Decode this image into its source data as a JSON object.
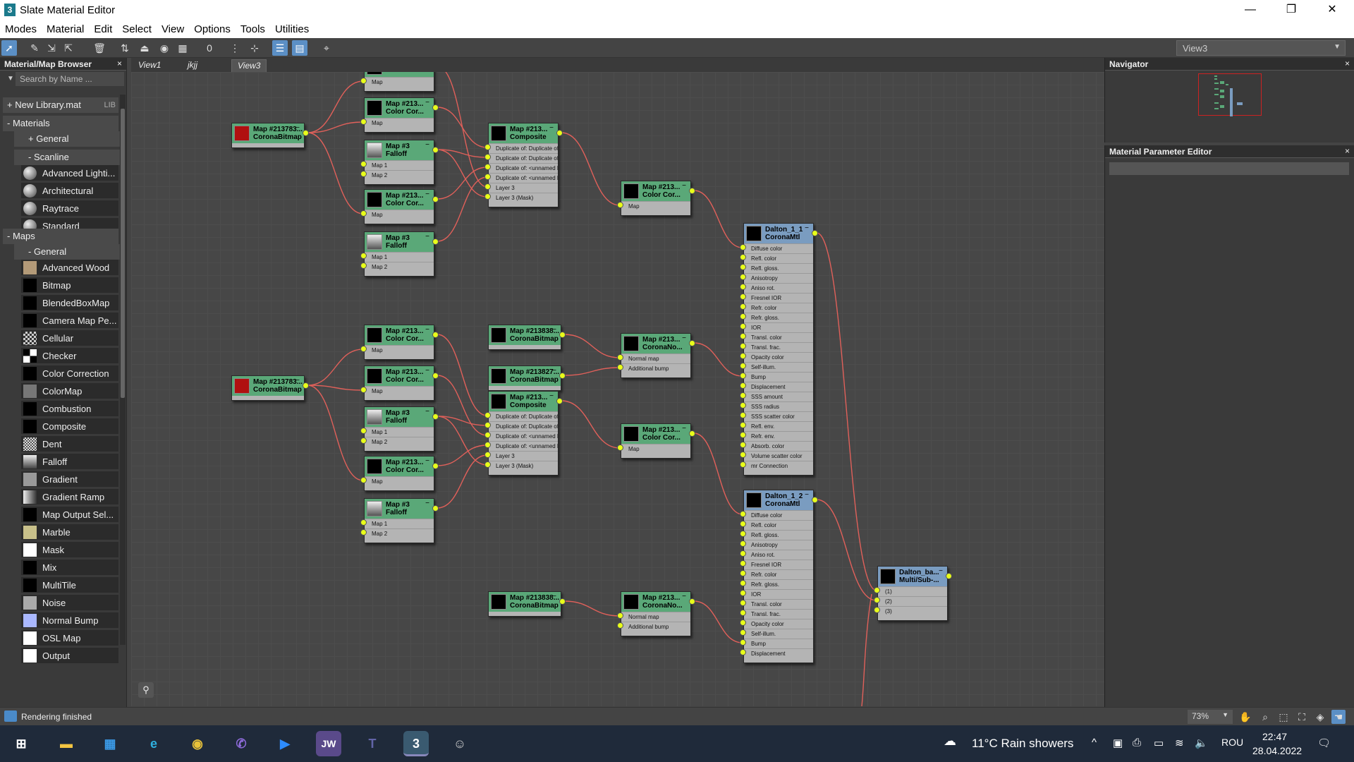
{
  "window": {
    "title": "Slate Material Editor",
    "minimize": "—",
    "restore": "❐",
    "close": "✕"
  },
  "menu": [
    "Modes",
    "Material",
    "Edit",
    "Select",
    "View",
    "Options",
    "Tools",
    "Utilities"
  ],
  "view_dropdown": "View3",
  "browser": {
    "title": "Material/Map Browser",
    "close": "×",
    "search_placeholder": "Search by Name ...",
    "library": "+ New Library.mat",
    "library_tag": "LIB",
    "materials": "- Materials",
    "general_mat": "+ General",
    "scanline": "- Scanline",
    "scanline_items": [
      "Advanced Lighti...",
      "Architectural",
      "Raytrace",
      "Standard"
    ],
    "maps": "- Maps",
    "general_maps": "- General",
    "map_items": [
      "Advanced Wood",
      "Bitmap",
      "BlendedBoxMap",
      "Camera Map Pe...",
      "Cellular",
      "Checker",
      "Color Correction",
      "ColorMap",
      "Combustion",
      "Composite",
      "Dent",
      "Falloff",
      "Gradient",
      "Gradient Ramp",
      "Map Output Sel...",
      "Marble",
      "Mask",
      "Mix",
      "MultiTile",
      "Noise",
      "Normal Bump",
      "OSL Map",
      "Output"
    ]
  },
  "tabs": [
    "View1",
    "jkjj",
    "View3"
  ],
  "nodes": {
    "top_map": {
      "title": "",
      "type": "",
      "slots": [
        "Map"
      ]
    },
    "bmp1": {
      "title": "Map #213783...",
      "type": "CoronaBitmap"
    },
    "cc1": {
      "title": "Map #213...",
      "type": "Color Cor...",
      "slots": [
        "Map"
      ]
    },
    "fo1": {
      "title": "Map #3",
      "type": "Falloff",
      "slots": [
        "Map 1",
        "Map 2"
      ]
    },
    "cc2": {
      "title": "Map #213...",
      "type": "Color Cor...",
      "slots": [
        "Map"
      ]
    },
    "fo2": {
      "title": "Map #3",
      "type": "Falloff",
      "slots": [
        "Map 1",
        "Map 2"
      ]
    },
    "comp1": {
      "title": "Map #213...",
      "type": "Composite",
      "slots": [
        "Duplicate of: Duplicate of...",
        "Duplicate of: Duplicate of...",
        "Duplicate of: <unnamed l...",
        "Duplicate of: <unnamed l...",
        "Layer 3",
        "Layer 3 (Mask)"
      ]
    },
    "cc3": {
      "title": "Map #213...",
      "type": "Color Cor...",
      "slots": [
        "Map"
      ]
    },
    "mtl1": {
      "title": "Dalton_1_1",
      "type": "CoronaMtl",
      "slots": [
        "Diffuse color",
        "Refl. color",
        "Refl. gloss.",
        "Anisotropy",
        "Aniso rot.",
        "Fresnel IOR",
        "Refr. color",
        "Refr. gloss.",
        "IOR",
        "Transl. color",
        "Transl. frac.",
        "Opacity color",
        "Self-illum.",
        "Bump",
        "Displacement",
        "SSS amount",
        "SSS radius",
        "SSS scatter color",
        "Refl. env.",
        "Refr. env.",
        "Absorb. color",
        "Volume scatter color",
        "mr Connection"
      ]
    },
    "cc4": {
      "title": "Map #213...",
      "type": "Color Cor...",
      "slots": [
        "Map"
      ]
    },
    "bmp2": {
      "title": "Map #213838...",
      "type": "CoronaBitmap"
    },
    "nrm1": {
      "title": "Map #213...",
      "type": "CoronaNo...",
      "slots": [
        "Normal map",
        "Additional bump"
      ]
    },
    "bmp3": {
      "title": "Map #213827...",
      "type": "CoronaBitmap"
    },
    "bmp4": {
      "title": "Map #213783...",
      "type": "CoronaBitmap"
    },
    "cc5": {
      "title": "Map #213...",
      "type": "Color Cor...",
      "slots": [
        "Map"
      ]
    },
    "comp2": {
      "title": "Map #213...",
      "type": "Composite",
      "slots": [
        "Duplicate of: Duplicate of...",
        "Duplicate of: Duplicate of...",
        "Duplicate of: <unnamed l...",
        "Duplicate of: <unnamed l...",
        "Layer 3",
        "Layer 3 (Mask)"
      ]
    },
    "fo3": {
      "title": "Map #3",
      "type": "Falloff",
      "slots": [
        "Map 1",
        "Map 2"
      ]
    },
    "cc6": {
      "title": "Map #213...",
      "type": "Color Cor...",
      "slots": [
        "Map"
      ]
    },
    "cc7": {
      "title": "Map #213...",
      "type": "Color Cor...",
      "slots": [
        "Map"
      ]
    },
    "fo4": {
      "title": "Map #3",
      "type": "Falloff",
      "slots": [
        "Map 1",
        "Map 2"
      ]
    },
    "mtl2": {
      "title": "Dalton_1_2",
      "type": "CoronaMtl",
      "slots": [
        "Diffuse color",
        "Refl. color",
        "Refl. gloss.",
        "Anisotropy",
        "Aniso rot.",
        "Fresnel IOR",
        "Refr. color",
        "Refr. gloss.",
        "IOR",
        "Transl. color",
        "Transl. frac.",
        "Opacity color",
        "Self-illum.",
        "Bump",
        "Displacement"
      ]
    },
    "multi": {
      "title": "Dalton_ba...",
      "type": "Multi/Sub-...",
      "slots": [
        "(1)",
        "(2)",
        "(3)"
      ]
    },
    "bmp5": {
      "title": "Map #213838...",
      "type": "CoronaBitmap"
    },
    "nrm2": {
      "title": "Map #213...",
      "type": "CoronaNo...",
      "slots": [
        "Normal map",
        "Additional bump"
      ]
    }
  },
  "navigator": {
    "title": "Navigator",
    "close": "×"
  },
  "mpe": {
    "title": "Material Parameter Editor",
    "close": "×"
  },
  "status": {
    "text": "Rendering finished",
    "zoom": "73%"
  },
  "taskbar": {
    "weather": "11°C  Rain showers",
    "lang": "ROU",
    "time": "22:47",
    "date": "28.04.2022"
  },
  "colors": {
    "node_header": "#5aa878",
    "mtl_header": "#7a9cc0",
    "wire": "#e0605a",
    "pin": "#e8ff1a"
  }
}
